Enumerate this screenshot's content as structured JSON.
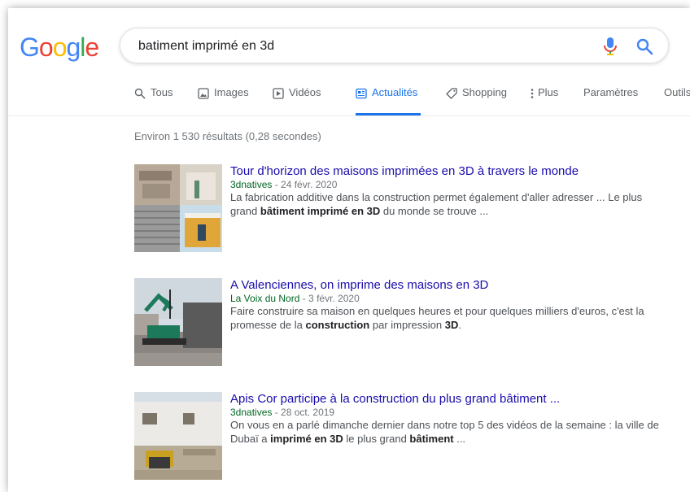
{
  "logo": {
    "letters": [
      {
        "ch": "G",
        "color": "#4285f4"
      },
      {
        "ch": "o",
        "color": "#ea4335"
      },
      {
        "ch": "o",
        "color": "#fbbc05"
      },
      {
        "ch": "g",
        "color": "#4285f4"
      },
      {
        "ch": "l",
        "color": "#34a853"
      },
      {
        "ch": "e",
        "color": "#ea4335"
      }
    ]
  },
  "search": {
    "query": "batiment imprimé en 3d"
  },
  "tabs": [
    {
      "label": "Tous",
      "icon": "search-icon"
    },
    {
      "label": "Images",
      "icon": "image-icon"
    },
    {
      "label": "Vidéos",
      "icon": "video-icon"
    },
    {
      "label": "Actualités",
      "icon": "news-icon",
      "active": true
    },
    {
      "label": "Shopping",
      "icon": "tag-icon"
    },
    {
      "label": "Plus",
      "icon": "more-vert-icon"
    },
    {
      "label": "Paramètres"
    },
    {
      "label": "Outils"
    }
  ],
  "stats": "Environ 1 530 résultats (0,28 secondes)",
  "results": [
    {
      "title": "Tour d'horizon des maisons imprimées en 3D à travers le monde",
      "source": "3dnatives",
      "date": " - 24 févr. 2020",
      "snippet_parts": [
        {
          "t": "La fabrication additive dans la construction permet également d'aller adresser ... Le plus grand "
        },
        {
          "t": "bâtiment imprimé en 3D",
          "b": true
        },
        {
          "t": " du monde se trouve ..."
        }
      ]
    },
    {
      "title": "A Valenciennes, on imprime des maisons en 3D",
      "source": "La Voix du Nord",
      "date": " - 3 févr. 2020",
      "snippet_parts": [
        {
          "t": "Faire construire sa maison en quelques heures et pour quelques milliers d'euros, c'est la promesse de la "
        },
        {
          "t": "construction",
          "b": true
        },
        {
          "t": " par impression "
        },
        {
          "t": "3D",
          "b": true
        },
        {
          "t": "."
        }
      ]
    },
    {
      "title": "Apis Cor participe à la construction du plus grand bâtiment ...",
      "source": "3dnatives",
      "date": " - 28 oct. 2019",
      "snippet_parts": [
        {
          "t": "On vous en a parlé dimanche dernier dans notre top 5 des vidéos de la semaine : la ville de Dubaï a "
        },
        {
          "t": "imprimé en 3D",
          "b": true
        },
        {
          "t": " le plus grand "
        },
        {
          "t": "bâtiment",
          "b": true
        },
        {
          "t": " ..."
        }
      ]
    }
  ],
  "colors": {
    "link": "#1a0dab",
    "source": "#006621",
    "accent": "#1a73e8",
    "text": "#4d5156"
  }
}
